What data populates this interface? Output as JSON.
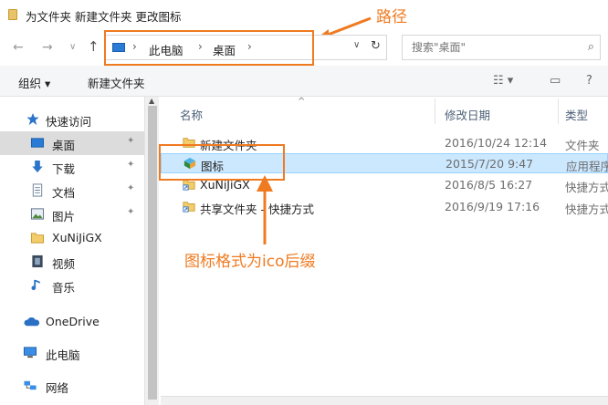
{
  "window": {
    "title": "为文件夹 新建文件夹 更改图标"
  },
  "annotations": {
    "path_label": "路径",
    "icon_format_label": "图标格式为ico后缀",
    "color": "#f07a20"
  },
  "navigation": {
    "back_icon": "left-arrow",
    "forward_icon": "right-arrow",
    "recent_icon": "chevron-down",
    "up_icon": "up-arrow"
  },
  "address_bar": {
    "crumbs": [
      "此电脑",
      "桌面"
    ],
    "separator": "›"
  },
  "search": {
    "placeholder": "搜索\"桌面\""
  },
  "toolbar": {
    "organize": "组织 ▾",
    "new_folder": "新建文件夹"
  },
  "sidebar": {
    "items": [
      {
        "label": "快速访问",
        "icon": "star-icon"
      },
      {
        "label": "桌面",
        "icon": "desktop-icon",
        "pinned": true,
        "selected": true
      },
      {
        "label": "下载",
        "icon": "download-icon",
        "pinned": true
      },
      {
        "label": "文档",
        "icon": "document-icon",
        "pinned": true
      },
      {
        "label": "图片",
        "icon": "picture-icon",
        "pinned": true
      },
      {
        "label": "XuNiJiGX",
        "icon": "folder-icon"
      },
      {
        "label": "视频",
        "icon": "video-icon"
      },
      {
        "label": "音乐",
        "icon": "music-icon"
      },
      {
        "label": "OneDrive",
        "icon": "cloud-icon"
      },
      {
        "label": "此电脑",
        "icon": "computer-icon"
      },
      {
        "label": "网络",
        "icon": "network-icon"
      }
    ]
  },
  "file_list": {
    "columns": [
      "名称",
      "修改日期",
      "类型"
    ],
    "rows": [
      {
        "name": "新建文件夹",
        "date": "2016/10/24 12:14",
        "type": "文件夹",
        "icon": "folder-icon"
      },
      {
        "name": "图标",
        "date": "2015/7/20 9:47",
        "type": "应用程序",
        "icon": "app-icon",
        "selected": true
      },
      {
        "name": "XuNiJiGX",
        "date": "2016/8/5 16:27",
        "type": "快捷方式",
        "icon": "shortcut-folder-icon"
      },
      {
        "name": "共享文件夹 - 快捷方式",
        "date": "2016/9/19 17:16",
        "type": "快捷方式",
        "icon": "shortcut-folder-icon"
      }
    ]
  }
}
